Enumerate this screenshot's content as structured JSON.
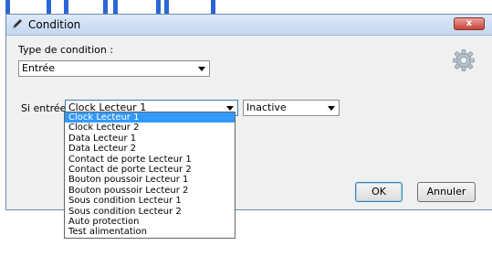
{
  "window": {
    "title": "Condition",
    "close_label": "x"
  },
  "type_condition": {
    "label": "Type de condition :",
    "value": "Entrée"
  },
  "si_entree": {
    "label": "Si entrée",
    "value": "Clock Lecteur 1",
    "state_value": "Inactive"
  },
  "dropdown": {
    "options": [
      "Clock Lecteur 1",
      "Clock Lecteur 2",
      "Data Lecteur 1",
      "Data Lecteur 2",
      "Contact de porte Lecteur 1",
      "Contact de porte Lecteur 2",
      "Bouton poussoir Lecteur 1",
      "Bouton poussoir Lecteur 2",
      "Sous condition Lecteur 1",
      "Sous condition Lecteur 2",
      "Auto protection",
      "Test alimentation"
    ],
    "selected_index": 0
  },
  "buttons": {
    "ok": "OK",
    "cancel": "Annuler"
  },
  "colors": {
    "selection": "#3399ff",
    "close": "#c8443a",
    "background_art": "#2a67d6"
  }
}
